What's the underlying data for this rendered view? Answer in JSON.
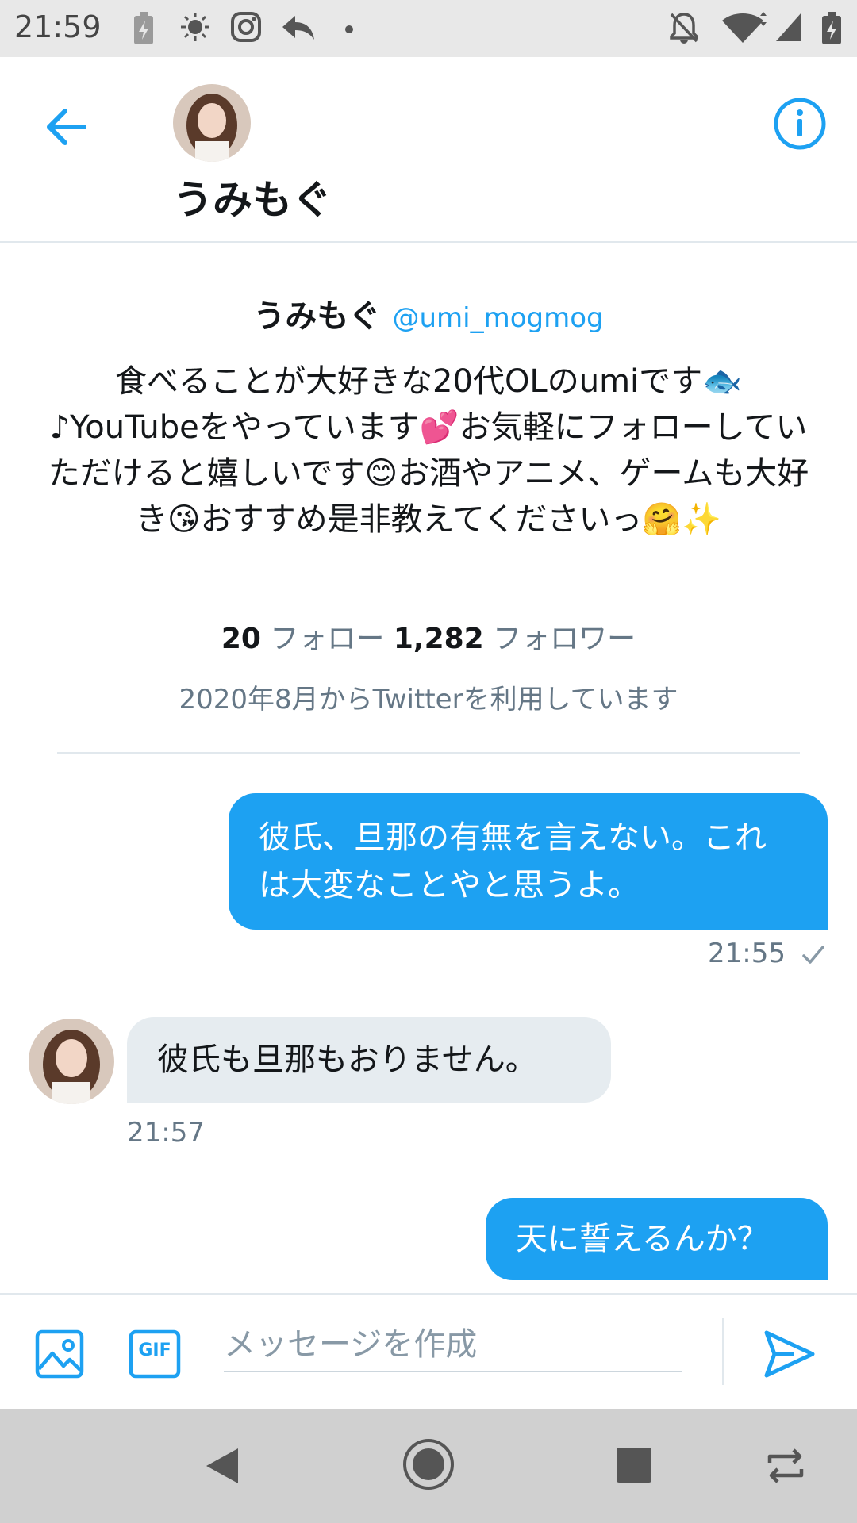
{
  "status_bar": {
    "time": "21:59",
    "icons": [
      "battery-saver-icon",
      "brightness-icon",
      "instagram-icon",
      "reply-icon",
      "dot-icon",
      "notifications-off-icon",
      "wifi-icon",
      "signal-icon",
      "battery-icon"
    ]
  },
  "header": {
    "name": "うみもぐ",
    "back_icon": "arrow-left-icon",
    "info_icon": "info-icon"
  },
  "profile": {
    "name": "うみもぐ",
    "handle": "@umi_mogmog",
    "bio": "食べることが大好きな20代OLのumiです🐟♪YouTubeをやっています💕お気軽にフォローしていただけると嬉しいです😊お酒やアニメ、ゲームも大好き😘おすすめ是非教えてくださいっ🤗✨",
    "following_count": "20",
    "following_label": "フォロー",
    "followers_count": "1,282",
    "followers_label": "フォロワー",
    "joined": "2020年8月からTwitterを利用しています"
  },
  "messages": [
    {
      "direction": "out",
      "text": "彼氏、旦那の有無を言えない。これは大変なことやと思うよ。",
      "time": "21:55",
      "status_icon": "check-icon"
    },
    {
      "direction": "in",
      "text": "彼氏も旦那もおりません。",
      "time": "21:57"
    },
    {
      "direction": "out",
      "text": "天に誓えるんか？"
    }
  ],
  "composer": {
    "placeholder": "メッセージを作成",
    "value": "",
    "image_icon": "image-icon",
    "gif_label": "GIF",
    "send_icon": "send-icon"
  },
  "nav_bar": {
    "icons": [
      "nav-back-icon",
      "nav-home-icon",
      "nav-recents-icon",
      "rotate-icon"
    ]
  },
  "colors": {
    "accent": "#1da1f2",
    "incoming_bubble": "#e6ecf0",
    "secondary_text": "#657786",
    "status_bar_bg": "#e8e8e8",
    "nav_bar_bg": "#d0d0d0"
  }
}
